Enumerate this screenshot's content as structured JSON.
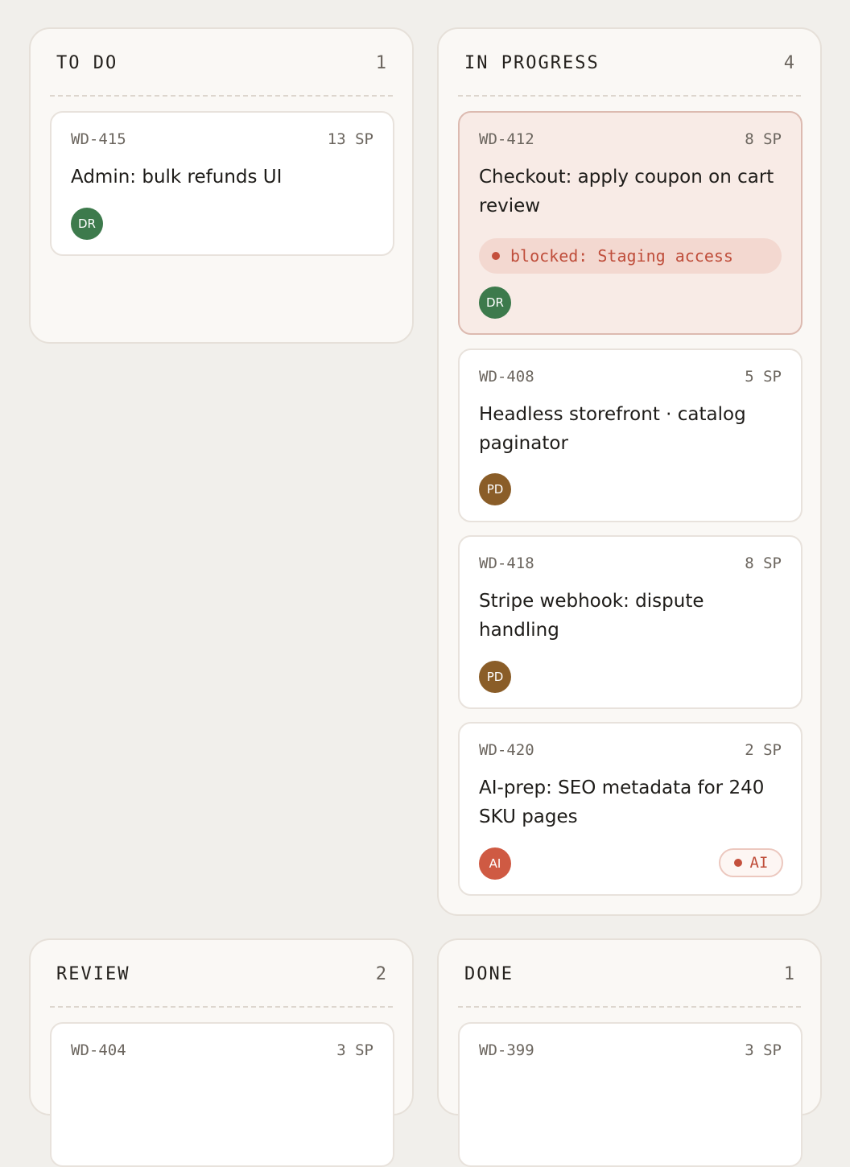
{
  "board": {
    "columns": [
      {
        "title": "TO DO",
        "count": "1",
        "cards": [
          {
            "id": "WD-415",
            "points": "13 SP",
            "title": "Admin: bulk refunds UI",
            "assignee": "DR",
            "assignee_color": "#3d7a4c"
          }
        ]
      },
      {
        "title": "IN PROGRESS",
        "count": "4",
        "cards": [
          {
            "id": "WD-412",
            "points": "8 SP",
            "title": "Checkout: apply coupon on cart review",
            "blocked": "blocked: Staging access",
            "assignee": "DR",
            "assignee_color": "#3d7a4c"
          },
          {
            "id": "WD-408",
            "points": "5 SP",
            "title": "Headless storefront · catalog paginator",
            "assignee": "PD",
            "assignee_color": "#8a5d28"
          },
          {
            "id": "WD-418",
            "points": "8 SP",
            "title": "Stripe webhook: dispute handling",
            "assignee": "PD",
            "assignee_color": "#8a5d28"
          },
          {
            "id": "WD-420",
            "points": "2 SP",
            "title": "AI-prep: SEO metadata for 240 SKU pages",
            "assignee": "AI",
            "assignee_color": "#cf5a43",
            "badge": "AI"
          }
        ]
      },
      {
        "title": "REVIEW",
        "count": "2",
        "cards": [
          {
            "id": "WD-404",
            "points": "3 SP"
          }
        ]
      },
      {
        "title": "DONE",
        "count": "1",
        "cards": [
          {
            "id": "WD-399",
            "points": "3 SP"
          }
        ]
      }
    ]
  },
  "colors": {
    "page_bg": "#f1efeb",
    "column_bg": "#faf8f5",
    "blocked_card_bg": "#f8ebe6",
    "blocked_text": "#bf4d3a"
  }
}
